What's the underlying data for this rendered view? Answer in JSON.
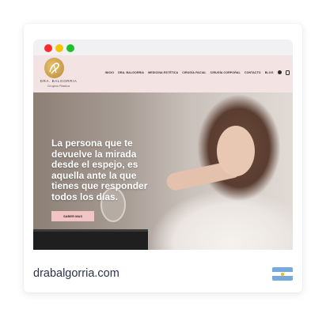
{
  "site_url": "drabalgorria.com",
  "logo": {
    "title": "DRA. BALGORRIA",
    "subtitle": "Cirujano Plástica"
  },
  "nav": {
    "items": [
      "INICIO",
      "DRA. BALGORRIA",
      "MEDICINA ESTÉTICA",
      "CIRUGÍA FACIAL",
      "CIRUGÍA CORPORAL",
      "CONTACTO",
      "BLOG"
    ],
    "social_icons": [
      "facebook-icon",
      "instagram-icon"
    ]
  },
  "hero": {
    "headline": "La persona que te devuelve la mirada desde el espejo, es aquella ante la que tienes que responder todos los días.",
    "cta_label": "SABER MAS"
  },
  "colors": {
    "header_bg": "#f3e3e3",
    "cta_bg": "#f2c4c4",
    "whatsapp": "#25d366",
    "browser_dots": [
      "#ff2b2b",
      "#f6c400",
      "#1fc12b"
    ]
  },
  "flag_icon": "argentina-flag-icon"
}
